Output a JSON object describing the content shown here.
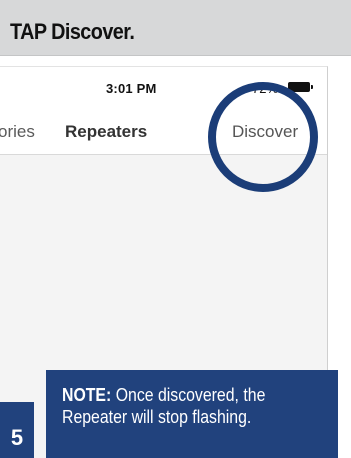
{
  "title": "TAP Discover.",
  "status_bar": {
    "time": "3:01 PM",
    "battery_percent": "72%",
    "battery_icon": "battery-icon"
  },
  "nav": {
    "tabs": [
      {
        "label": "ories"
      },
      {
        "label": "Repeaters",
        "selected": true
      },
      {
        "label": "Discover"
      }
    ]
  },
  "highlight_color": "#1b3d78",
  "note": {
    "label": "NOTE:",
    "line1": "Once discovered, the",
    "line2": "Repeater will stop flashing."
  },
  "step_number": "5",
  "colors": {
    "title_bar": "#d7d8d9",
    "accent_navy": "#21427d"
  }
}
